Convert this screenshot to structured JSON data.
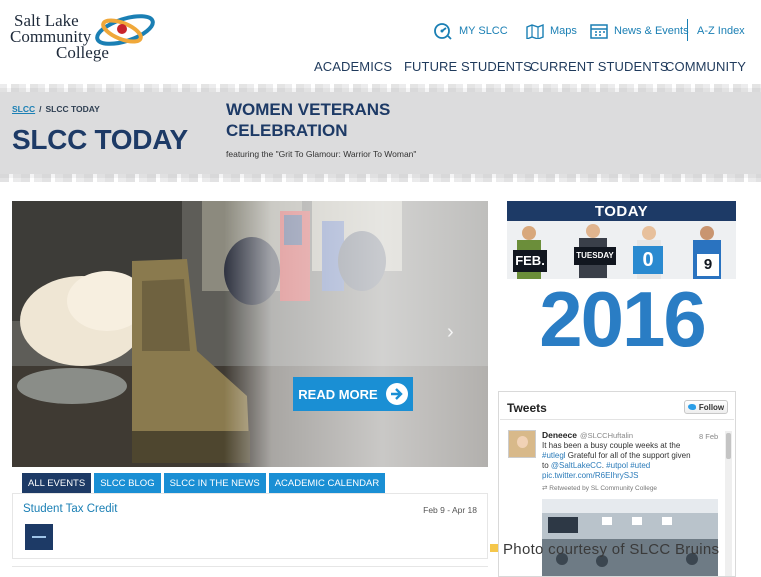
{
  "logo": {
    "line1": "Salt Lake",
    "line2": "Community",
    "line3": "College"
  },
  "utility_nav": {
    "my_slcc": "MY SLCC",
    "maps": "Maps",
    "news_events": "News & Events",
    "az_index": "A-Z Index"
  },
  "main_nav": [
    "ACADEMICS",
    "FUTURE STUDENTS",
    "CURRENT STUDENTS",
    "COMMUNITY"
  ],
  "breadcrumb": {
    "home": "SLCC",
    "separator": "/",
    "current": "SLCC TODAY"
  },
  "page_title": "SLCC TODAY",
  "hero": {
    "title": "WOMEN VETERANS CELEBRATION",
    "subtitle": "featuring the \"Grit To Glamour: Warrior To Woman\"",
    "button": "READ MORE"
  },
  "tabs": [
    "ALL EVENTS",
    "SLCC BLOG",
    "SLCC IN THE NEWS",
    "ACADEMIC CALENDAR"
  ],
  "event": {
    "name": "Student Tax Credit",
    "date": "Feb 9 - Apr 18"
  },
  "today": {
    "heading": "TODAY",
    "signs": [
      "FEB.",
      "TUESDAY",
      "0",
      "9"
    ],
    "year": "2016"
  },
  "tweets": {
    "heading": "Tweets",
    "follow": "Follow",
    "tweet": {
      "author": "Deneece",
      "handle": "@SLCCHuftalin",
      "date": "8 Feb",
      "text_line1": "It has been a busy couple weeks at the",
      "text_line2a": "#utlegl",
      "text_line2b": " Grateful for all of the support given",
      "text_line3a": "to ",
      "text_line3b": "@SaltLakeCC",
      "text_line3c": ". ",
      "text_line3d": "#utpol #uted",
      "text_line4": "pic.twitter.com/R6EIhrySJS",
      "retweet": "Retweeted by SL Community College"
    }
  },
  "caption": {
    "lead": "Photo courtesy of ",
    "tail": "SLCC Bruins"
  },
  "colors": {
    "navy": "#1d3a66",
    "blue": "#1a8fd4",
    "link": "#1a7fb4",
    "year": "#2a7dc4"
  }
}
